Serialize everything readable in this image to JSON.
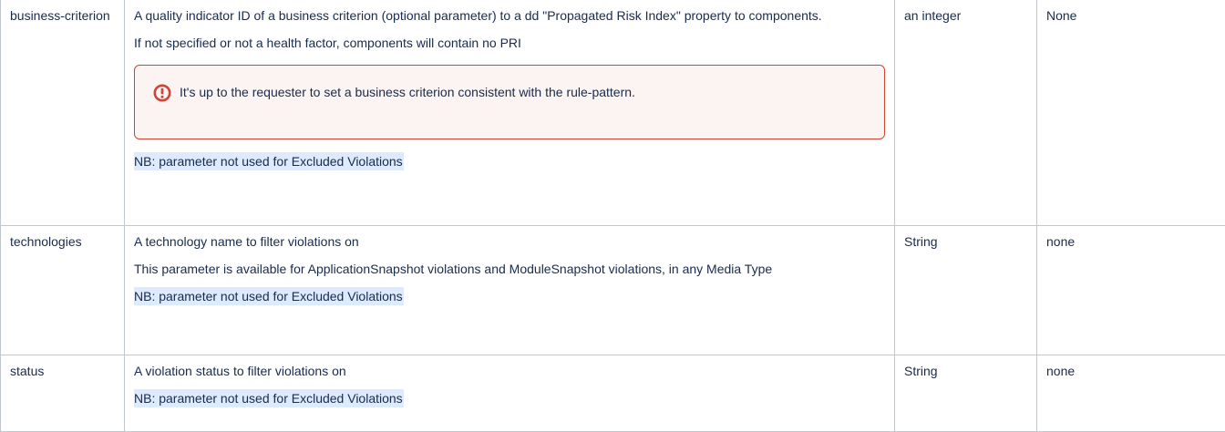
{
  "rows": [
    {
      "name": "business-criterion",
      "desc_1": "A quality indicator ID of a business criterion (optional parameter) to a dd \"Propagated Risk Index\" property to components.",
      "desc_2": "If not specified or not a health factor, components will contain no PRI",
      "warning": "It's up to the requester to set a business criterion consistent with the rule-pattern.",
      "note": "NB: parameter not used for Excluded Violations",
      "type": "an integer",
      "default": "None"
    },
    {
      "name": "technologies",
      "desc_1": "A technology name to filter violations on",
      "desc_2": "This parameter is available for ApplicationSnapshot violations and ModuleSnapshot violations, in any Media Type",
      "note": "NB: parameter not used for Excluded Violations",
      "type": "String",
      "default": "none"
    },
    {
      "name": "status",
      "desc_1": "A violation status to filter violations on",
      "note": "NB: parameter not used for Excluded Violations",
      "type": "String",
      "default": "none"
    }
  ],
  "icons": {
    "warning": "exclamation-circle-icon"
  },
  "colors": {
    "warning_border": "#d04437",
    "warning_background": "#fcf4f2",
    "note_highlight": "#deebff",
    "table_border": "#c1c7d0"
  }
}
